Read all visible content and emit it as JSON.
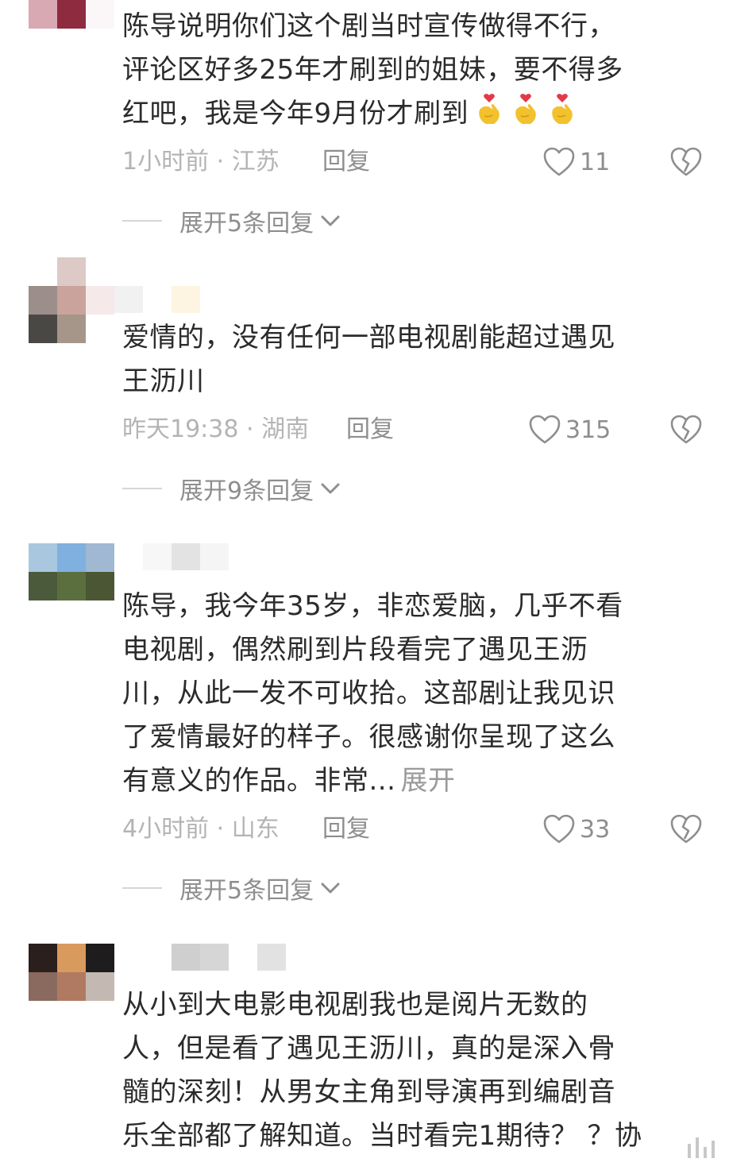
{
  "comments": [
    {
      "lines": [
        "陈导说明你们这个剧当时宣传做得不行，",
        "评论区好多25年才刷到的姐妹，要不得多",
        "红吧，我是今年9月份才刷到"
      ],
      "time_location": "1小时前 · 江苏",
      "reply_label": "回复",
      "like_count": "11",
      "expand_replies": "展开5条回复"
    },
    {
      "lines": [
        "爱情的，没有任何一部电视剧能超过遇见",
        "王沥川"
      ],
      "time_location": "昨天19:38 · 湖南",
      "reply_label": "回复",
      "like_count": "315",
      "expand_replies": "展开9条回复"
    },
    {
      "lines": [
        "陈导，我今年35岁，非恋爱脑，几乎不看",
        "电视剧，偶然刷到片段看完了遇见王沥",
        "川，从此一发不可收拾。这部剧让我见识",
        "了爱情最好的样子。很感谢你呈现了这么",
        "有意义的作品。非常..."
      ],
      "expand_text": "展开",
      "time_location": "4小时前 · 山东",
      "reply_label": "回复",
      "like_count": "33",
      "expand_replies": "展开5条回复"
    },
    {
      "lines": [
        "从小到大电影电视剧我也是阅片无数的",
        "人，但是看了遇见王沥川，真的是深入骨",
        "髓的深刻！从男女主角到导演再到编剧音",
        "乐全部都了解知道。当时看完1期待？ ？协"
      ]
    }
  ],
  "colors": {
    "text": "#2b2b2b",
    "meta": "#b4b4b4",
    "action": "#8e8e8e",
    "heart_emoji": "#f2c12e"
  },
  "icons": {
    "like": "heart-outline-icon",
    "dislike": "broken-heart-icon",
    "expand": "chevron-down-icon",
    "emoji": "finger-heart-emoji"
  }
}
